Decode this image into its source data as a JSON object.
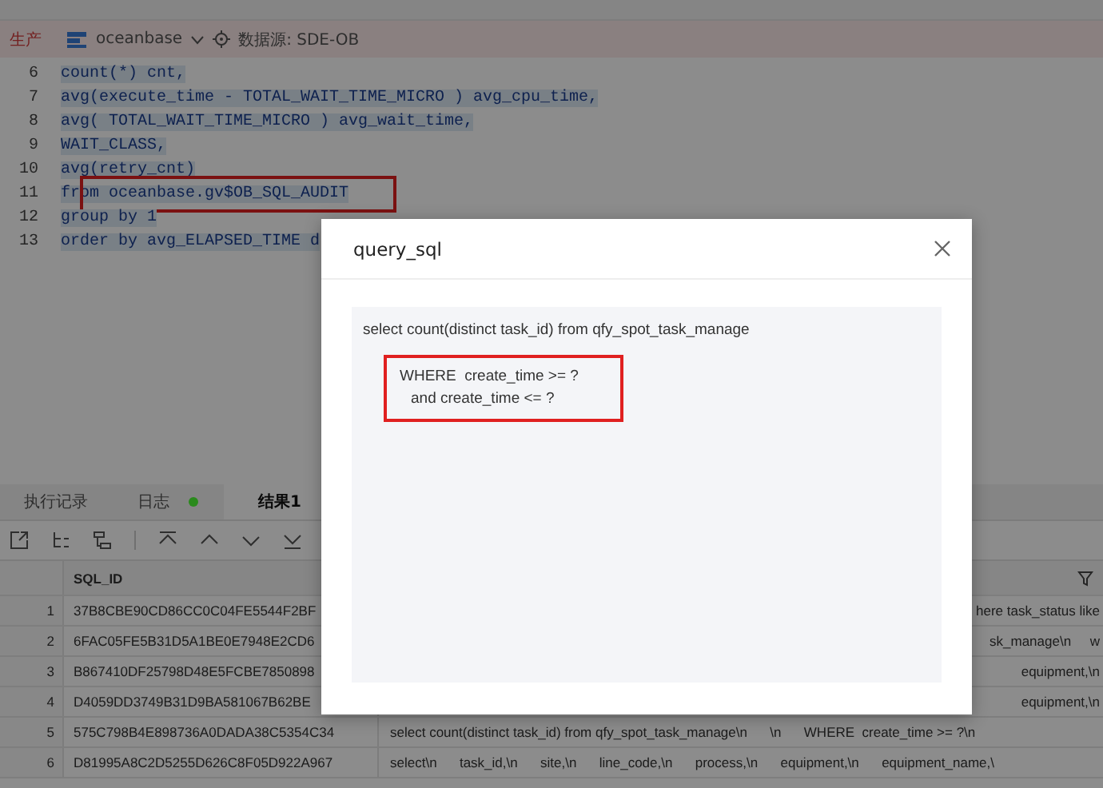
{
  "env_bar": {
    "env_label": "生产",
    "database": "oceanbase",
    "datasource": "数据源: SDE-OB"
  },
  "editor": {
    "lines": [
      {
        "number": "6",
        "code": "count(*) cnt,",
        "highlighted": false
      },
      {
        "number": "7",
        "code": "avg(execute_time - TOTAL_WAIT_TIME_MICRO ) avg_cpu_time,",
        "highlighted": false
      },
      {
        "number": "8",
        "code": "avg( TOTAL_WAIT_TIME_MICRO ) avg_wait_time,",
        "highlighted": false
      },
      {
        "number": "9",
        "code": "WAIT_CLASS,",
        "highlighted": false
      },
      {
        "number": "10",
        "code": "avg(retry_cnt)",
        "highlighted": false
      },
      {
        "number": "11",
        "code": "from oceanbase.gv$OB_SQL_AUDIT",
        "highlighted": true
      },
      {
        "number": "12",
        "code": "group by 1",
        "highlighted": false
      },
      {
        "number": "13",
        "code": "order by avg_ELAPSED_TIME d",
        "highlighted": false
      }
    ]
  },
  "bottom_tabs": [
    {
      "label": "执行记录",
      "selected": false
    },
    {
      "label": "日志",
      "selected": false,
      "color": "#2a8a1c"
    },
    {
      "label": "结果1",
      "selected": true
    }
  ],
  "table": {
    "columns": [
      "SQL_ID"
    ],
    "rows": [
      {
        "number": "1",
        "sql_id": "37B8CBE90CD86CC0C04FE5544F2BF",
        "column_3": "here task_status like"
      },
      {
        "number": "2",
        "sql_id": "6FAC05FE5B31D5A1BE0E7948E2CD6",
        "column_3": "sk_manage\\n     w"
      },
      {
        "number": "3",
        "sql_id": "B867410DF25798D48E5FCBE7850898",
        "column_3": "equipment,\\n"
      },
      {
        "number": "4",
        "sql_id": "D4059DD3749B31D9BA581067B62BE",
        "column_3": "equipment,\\n"
      },
      {
        "number": "5",
        "sql_id": "575C798B4E898736A0DADA38C5354C34",
        "column_3": "select count(distinct task_id) from qfy_spot_task_manage\\n      \\n      WHERE  create_time >= ?\\n"
      },
      {
        "number": "6",
        "sql_id": "D81995A8C2D5255D626C8F05D922A967",
        "column_3": "select\\n      task_id,\\n      site,\\n      line_code,\\n      process,\\n      equipment,\\n      equipment_name,\\"
      }
    ]
  },
  "modal": {
    "title": "query_sql",
    "sql_first_line": "select count(distinct task_id) from qfy_spot_task_manage",
    "highlighted_lines": [
      "WHERE  create_time >= ?",
      "and create_time <= ?"
    ]
  }
}
